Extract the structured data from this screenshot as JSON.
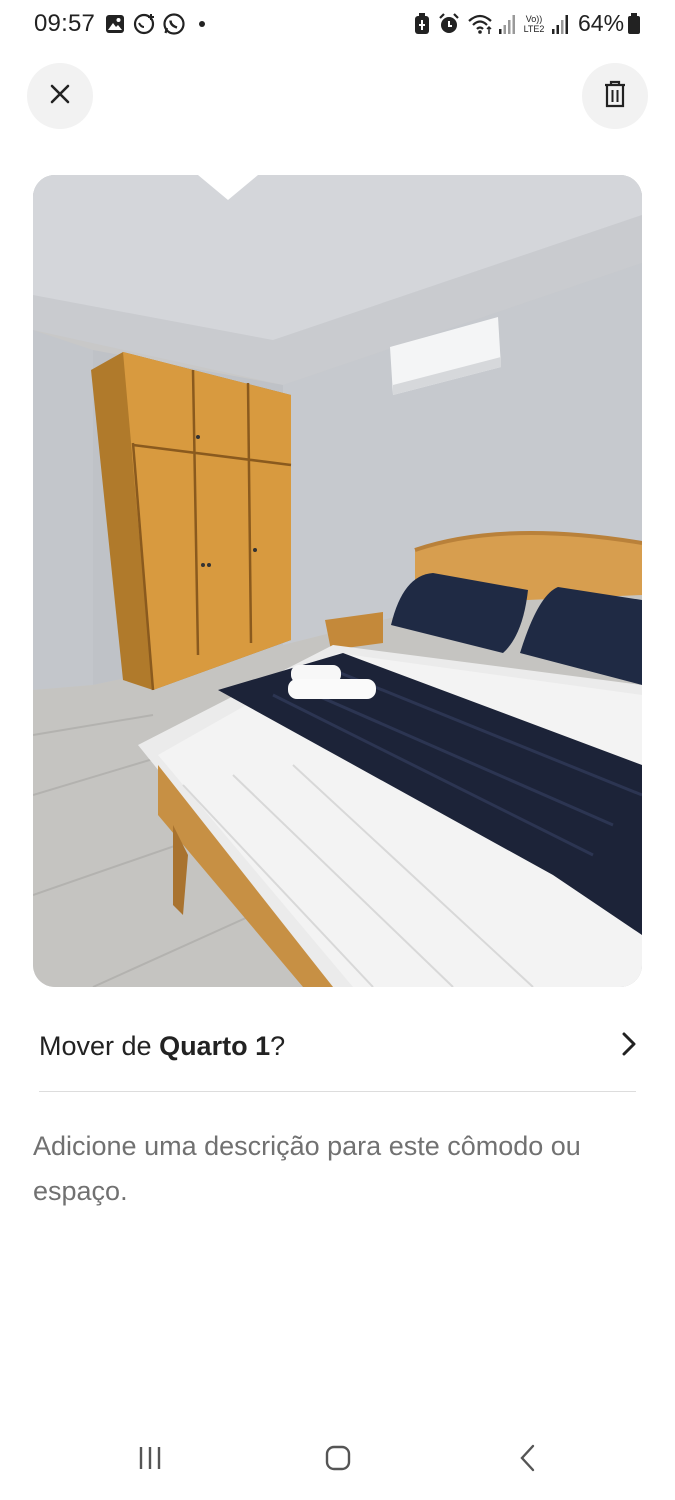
{
  "status_bar": {
    "time": "09:57",
    "battery": "64%",
    "signal_label": "Vo)) LTE2"
  },
  "header": {
    "close_icon": "close-icon",
    "delete_icon": "trash-icon"
  },
  "photo": {
    "subject": "bedroom-photo"
  },
  "move_row": {
    "prefix": "Mover de ",
    "room": "Quarto 1",
    "suffix": "?"
  },
  "description": {
    "placeholder": "Adicione uma descrição para este cômodo ou espaço."
  },
  "nav": {
    "recents_icon": "recents-icon",
    "home_icon": "home-icon",
    "back_icon": "back-icon"
  },
  "colors": {
    "text": "#222222",
    "muted": "#717171",
    "button_bg": "#f2f2f2",
    "divider": "#dddddd"
  }
}
